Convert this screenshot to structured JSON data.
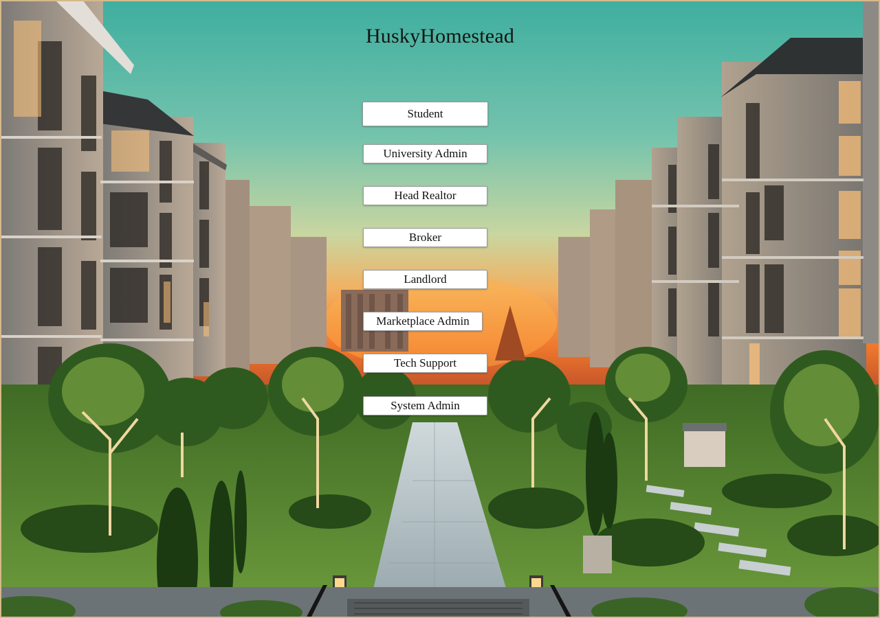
{
  "app": {
    "title": "HuskyHomestead"
  },
  "roles": {
    "student": "Student",
    "university_admin": "University Admin",
    "head_realtor": "Head Realtor",
    "broker": "Broker",
    "landlord": "Landlord",
    "marketplace_admin": "Marketplace Admin",
    "tech_support": "Tech Support",
    "system_admin": "System Admin"
  },
  "colors": {
    "sky_top": "#4fb8a8",
    "sky_sunset": "#f08a3a",
    "lawn": "#4f7a2c",
    "button_bg": "#ffffff",
    "frame": "#d6b98a"
  }
}
